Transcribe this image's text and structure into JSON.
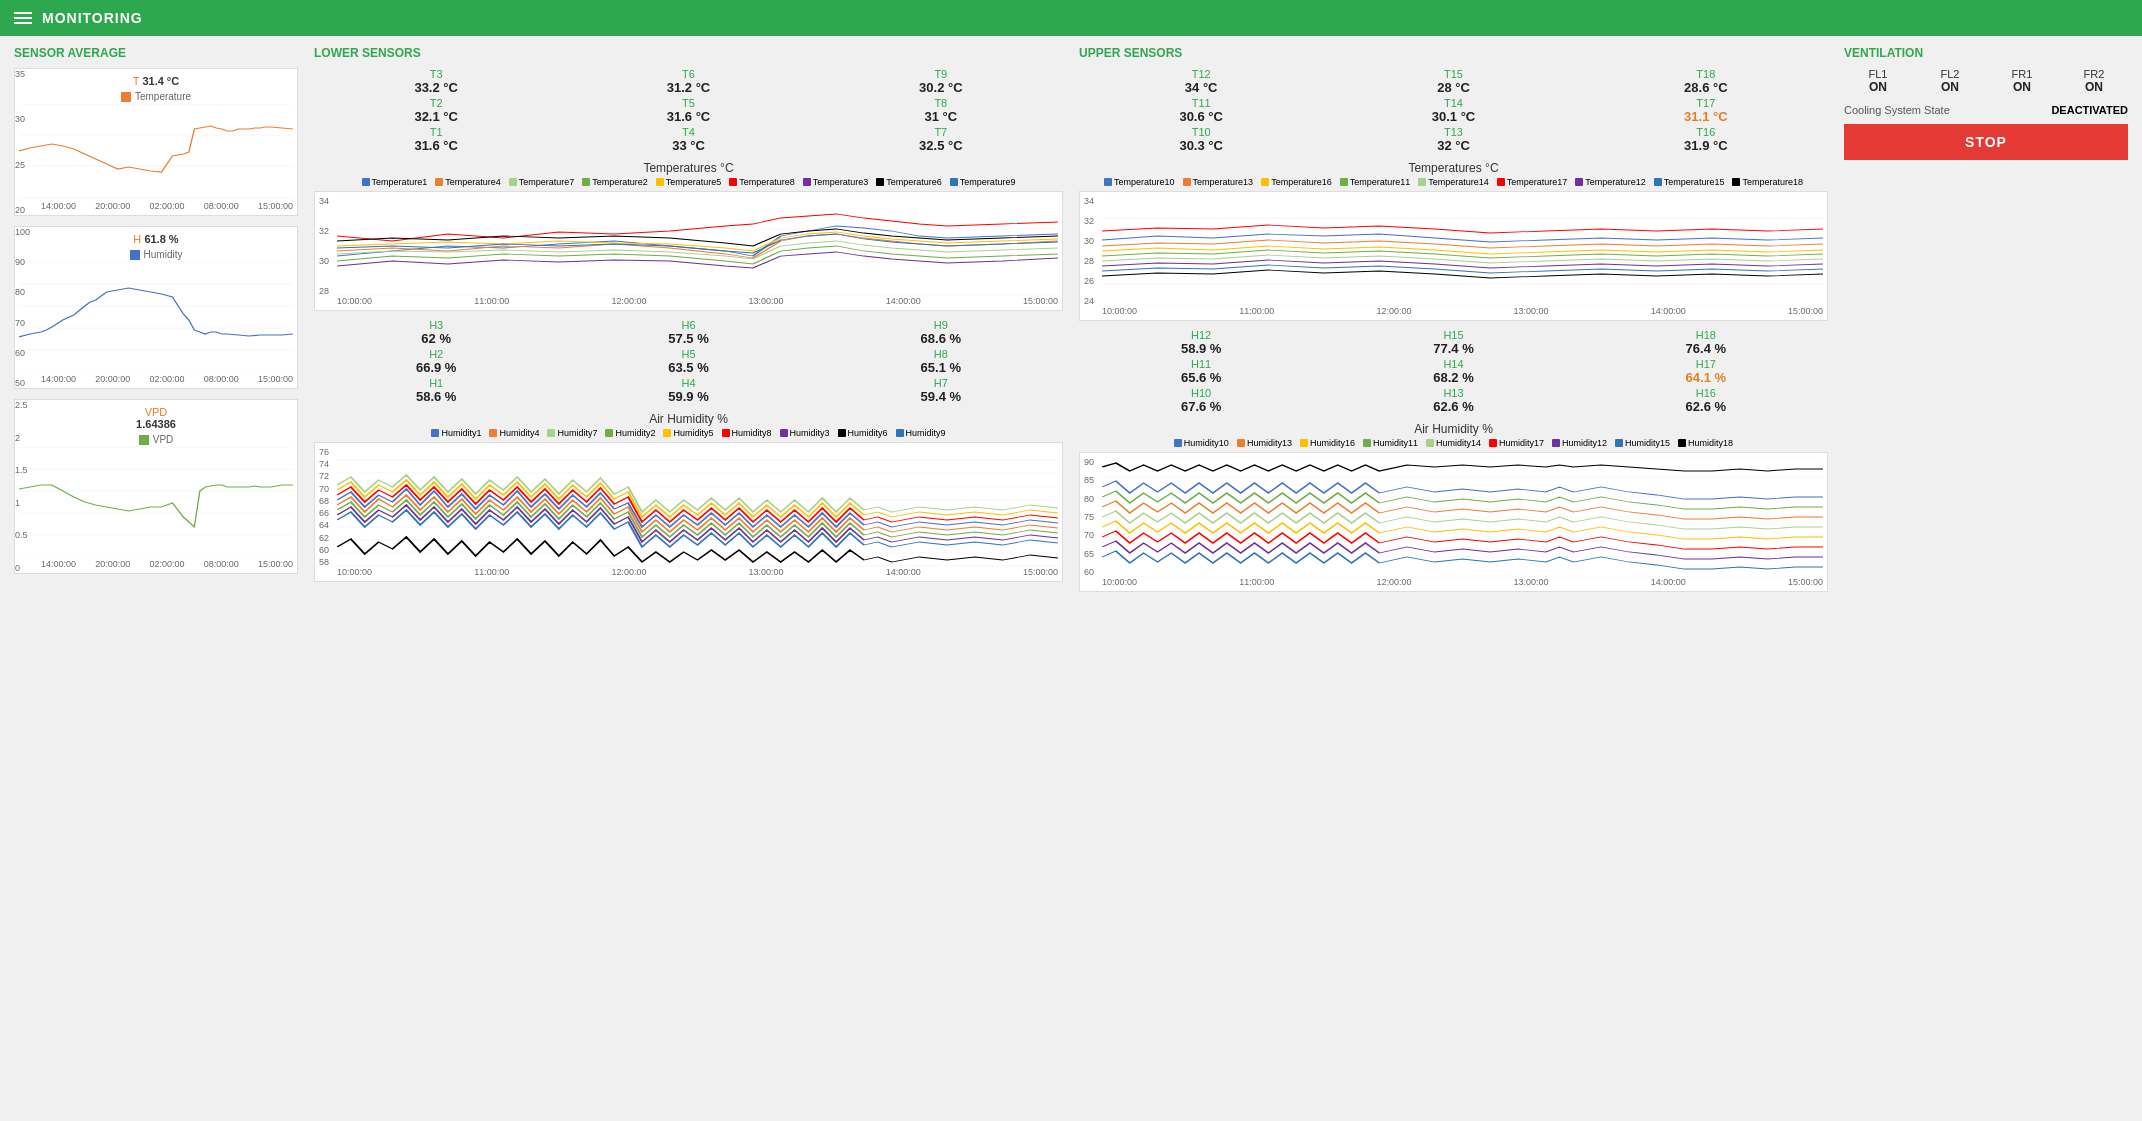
{
  "header": {
    "title": "MONITORING"
  },
  "sensor_average": {
    "section_title": "SENSOR AVERAGE",
    "temperature": {
      "label": "T",
      "value": "31.4 °C",
      "legend": "Temperature",
      "y_max": "35",
      "y_mid": "30",
      "y_low": "25",
      "y_min": "20",
      "x_labels": [
        "14:00:00",
        "20:00:00",
        "02:00:00",
        "08:00:00",
        "15:00:00"
      ]
    },
    "humidity": {
      "label": "H",
      "value": "61.8 %",
      "legend": "Humidity",
      "y_max": "100",
      "y_75": "90",
      "y_50": "80",
      "y_25": "70",
      "y_low": "60",
      "y_min": "50",
      "x_labels": [
        "14:00:00",
        "20:00:00",
        "02:00:00",
        "08:00:00",
        "15:00:00"
      ]
    },
    "vpd": {
      "label": "VPD",
      "value": "1.64386",
      "legend": "VPD",
      "y_max": "2.5",
      "y_2": "2",
      "y_1_5": "1.5",
      "y_1": "1",
      "y_0_5": "0.5",
      "y_min": "0",
      "x_labels": [
        "14:00:00",
        "20:00:00",
        "02:00:00",
        "08:00:00",
        "15:00:00"
      ]
    }
  },
  "lower_sensors": {
    "section_title": "LOWER SENSORS",
    "temps": [
      {
        "id": "T3",
        "val": "33.2 °C"
      },
      {
        "id": "T6",
        "val": "31.2 °C"
      },
      {
        "id": "T9",
        "val": "30.2 °C"
      },
      {
        "id": "T2",
        "val": "32.1 °C"
      },
      {
        "id": "T5",
        "val": "31.6 °C"
      },
      {
        "id": "T8",
        "val": "31 °C"
      },
      {
        "id": "T1",
        "val": "31.6 °C"
      },
      {
        "id": "T4",
        "val": "33 °C"
      },
      {
        "id": "T7",
        "val": "32.5 °C"
      }
    ],
    "temp_chart_title": "Temperatures °C",
    "temp_legends": [
      {
        "label": "Temperature1",
        "color": "#4472C4"
      },
      {
        "label": "Temperature4",
        "color": "#ED7D31"
      },
      {
        "label": "Temperature7",
        "color": "#A9D18E"
      },
      {
        "label": "Temperature2",
        "color": "#70AD47"
      },
      {
        "label": "Temperature5",
        "color": "#FFC000"
      },
      {
        "label": "Temperature8",
        "color": "#FF0000"
      },
      {
        "label": "Temperature3",
        "color": "#7030A0"
      },
      {
        "label": "Temperature6",
        "color": "#000000"
      },
      {
        "label": "Temperature9",
        "color": "#2E75B6"
      }
    ],
    "humids": [
      {
        "id": "H3",
        "val": "62 %"
      },
      {
        "id": "H6",
        "val": "57.5 %"
      },
      {
        "id": "H9",
        "val": "68.6 %"
      },
      {
        "id": "H2",
        "val": "66.9 %"
      },
      {
        "id": "H5",
        "val": "63.5 %"
      },
      {
        "id": "H8",
        "val": "65.1 %"
      },
      {
        "id": "H1",
        "val": "58.6 %"
      },
      {
        "id": "H4",
        "val": "59.9 %"
      },
      {
        "id": "H7",
        "val": "59.4 %"
      }
    ],
    "humid_chart_title": "Air Humidity %",
    "humid_legends": [
      {
        "label": "Humidity1",
        "color": "#4472C4"
      },
      {
        "label": "Humidity4",
        "color": "#ED7D31"
      },
      {
        "label": "Humidity7",
        "color": "#A9D18E"
      },
      {
        "label": "Humidity2",
        "color": "#70AD47"
      },
      {
        "label": "Humidity5",
        "color": "#FFC000"
      },
      {
        "label": "Humidity8",
        "color": "#FF0000"
      },
      {
        "label": "Humidity3",
        "color": "#7030A0"
      },
      {
        "label": "Humidity6",
        "color": "#000000"
      },
      {
        "label": "Humidity9",
        "color": "#2E75B6"
      }
    ]
  },
  "upper_sensors": {
    "section_title": "UPPER SENSORS",
    "temps": [
      {
        "id": "T12",
        "val": "34 °C"
      },
      {
        "id": "T15",
        "val": "28 °C"
      },
      {
        "id": "T18",
        "val": "28.6 °C"
      },
      {
        "id": "T11",
        "val": "30.6 °C"
      },
      {
        "id": "T14",
        "val": "30.1 °C"
      },
      {
        "id": "T17",
        "val": "31.1 °C",
        "orange": true
      },
      {
        "id": "T10",
        "val": "30.3 °C"
      },
      {
        "id": "T13",
        "val": "32 °C"
      },
      {
        "id": "T16",
        "val": "31.9 °C"
      }
    ],
    "temp_chart_title": "Temperatures °C",
    "temp_legends": [
      {
        "label": "Temperature10",
        "color": "#4472C4"
      },
      {
        "label": "Temperature13",
        "color": "#ED7D31"
      },
      {
        "label": "Temperature16",
        "color": "#FFC000"
      },
      {
        "label": "Temperature11",
        "color": "#70AD47"
      },
      {
        "label": "Temperature14",
        "color": "#A9D18E"
      },
      {
        "label": "Temperature17",
        "color": "#FF0000"
      },
      {
        "label": "Temperature12",
        "color": "#7030A0"
      },
      {
        "label": "Temperature15",
        "color": "#2E75B6"
      },
      {
        "label": "Temperature18",
        "color": "#000000"
      }
    ],
    "humids": [
      {
        "id": "H12",
        "val": "58.9 %"
      },
      {
        "id": "H15",
        "val": "77.4 %"
      },
      {
        "id": "H18",
        "val": "76.4 %"
      },
      {
        "id": "H11",
        "val": "65.6 %"
      },
      {
        "id": "H14",
        "val": "68.2 %"
      },
      {
        "id": "H17",
        "val": "64.1 %",
        "orange": true
      },
      {
        "id": "H10",
        "val": "67.6 %"
      },
      {
        "id": "H13",
        "val": "62.6 %"
      },
      {
        "id": "H16",
        "val": "62.6 %"
      }
    ],
    "humid_chart_title": "Air Humidity %",
    "humid_legends": [
      {
        "label": "Humidity10",
        "color": "#4472C4"
      },
      {
        "label": "Humidity13",
        "color": "#ED7D31"
      },
      {
        "label": "Humidity16",
        "color": "#FFC000"
      },
      {
        "label": "Humidity11",
        "color": "#70AD47"
      },
      {
        "label": "Humidity14",
        "color": "#A9D18E"
      },
      {
        "label": "Humidity17",
        "color": "#FF0000"
      },
      {
        "label": "Humidity12",
        "color": "#7030A0"
      },
      {
        "label": "Humidity15",
        "color": "#2E75B6"
      },
      {
        "label": "Humidity18",
        "color": "#000000"
      }
    ]
  },
  "ventilation": {
    "section_title": "VENTILATION",
    "fans": [
      {
        "id": "FL1",
        "state": "ON"
      },
      {
        "id": "FL2",
        "state": "ON"
      },
      {
        "id": "FR1",
        "state": "ON"
      },
      {
        "id": "FR2",
        "state": "ON"
      }
    ],
    "cooling_label": "Cooling System State",
    "cooling_state": "DEACTIVATED",
    "stop_label": "STOP"
  }
}
